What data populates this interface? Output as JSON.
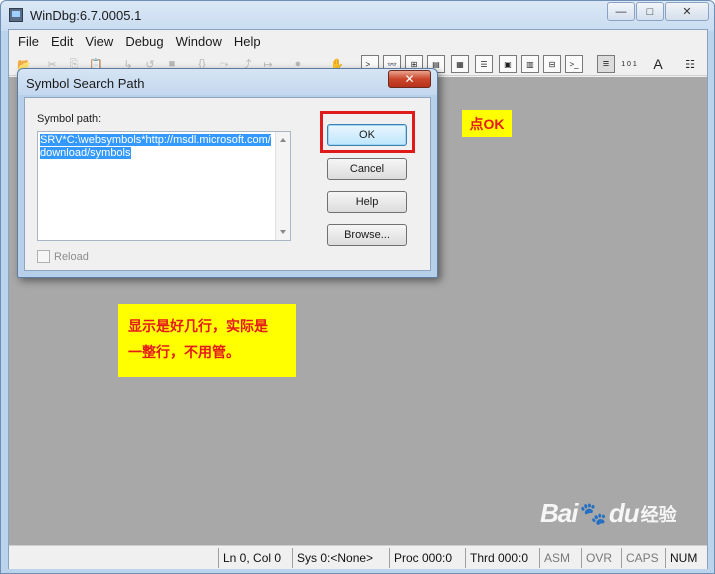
{
  "window": {
    "title": "WinDbg:6.7.0005.1"
  },
  "caption_buttons": {
    "minimize": "—",
    "maximize": "□",
    "close": "✕"
  },
  "menu": [
    "File",
    "Edit",
    "View",
    "Debug",
    "Window",
    "Help"
  ],
  "toolbar": {
    "icons": [
      {
        "name": "open-icon",
        "glyph": "📂"
      },
      {
        "name": "cut-icon",
        "glyph": "✂"
      },
      {
        "name": "copy-icon",
        "glyph": "⎘"
      },
      {
        "name": "paste-icon",
        "glyph": "📋"
      },
      {
        "name": "go-icon",
        "glyph": "↳"
      },
      {
        "name": "restart-icon",
        "glyph": "↺"
      },
      {
        "name": "stop-icon",
        "glyph": "■"
      },
      {
        "name": "break-icon",
        "glyph": "✋"
      },
      {
        "name": "step-into-icon",
        "glyph": "{}"
      },
      {
        "name": "step-over-icon",
        "glyph": "⤳"
      },
      {
        "name": "step-out-icon",
        "glyph": "⤴"
      },
      {
        "name": "run-to-cursor-icon",
        "glyph": "↦"
      },
      {
        "name": "breakpoint-icon",
        "glyph": "●"
      },
      {
        "name": "source-mode-icon",
        "glyph": "≡"
      },
      {
        "name": "command-window-icon",
        "glyph": ">_"
      },
      {
        "name": "watch-window-icon",
        "glyph": "👓"
      },
      {
        "name": "locals-window-icon",
        "glyph": "⊞"
      },
      {
        "name": "registers-window-icon",
        "glyph": "▤"
      },
      {
        "name": "memory-window-icon",
        "glyph": "▦"
      },
      {
        "name": "callstack-window-icon",
        "glyph": "☰"
      },
      {
        "name": "disassembly-window-icon",
        "glyph": "▣"
      },
      {
        "name": "scratchpad-window-icon",
        "glyph": "▥"
      },
      {
        "name": "processes-threads-icon",
        "glyph": "⊟"
      },
      {
        "name": "source-window-icon",
        "glyph": "≣"
      },
      {
        "name": "hex-mode-icon",
        "glyph": "1 0 1"
      },
      {
        "name": "font-icon",
        "glyph": "A"
      },
      {
        "name": "options-icon",
        "glyph": "☷"
      }
    ]
  },
  "dialog": {
    "title": "Symbol Search Path",
    "close": "✕",
    "symbol_path_label": "Symbol path:",
    "symbol_path_value": "SRV*C:\\websymbols*http://msdl.microsoft.com/download/symbols",
    "reload_label": "Reload",
    "buttons": {
      "ok": "OK",
      "cancel": "Cancel",
      "help": "Help",
      "browse": "Browse..."
    }
  },
  "annotations": {
    "ok_note": "点OK",
    "main_note_line1": "显示是好几行，实际是",
    "main_note_line2": "一整行，不用管。"
  },
  "statusbar": {
    "line_col": "Ln 0, Col 0",
    "sys": "Sys 0:<None>",
    "proc": "Proc 000:0",
    "thrd": "Thrd 000:0",
    "asm": "ASM",
    "ovr": "OVR",
    "caps": "CAPS",
    "num": "NUM"
  },
  "watermark": {
    "brand_left": "Bai",
    "paw": "🐾",
    "brand_right": "du",
    "sub": "经验"
  }
}
